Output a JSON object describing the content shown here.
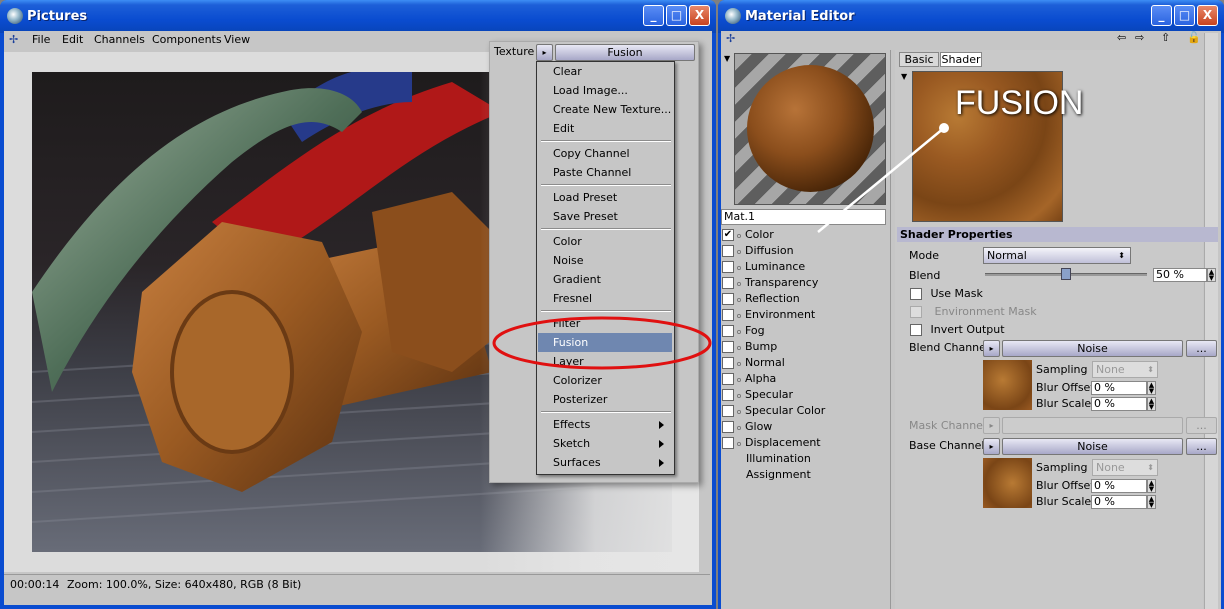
{
  "pictures": {
    "title": "Pictures",
    "menu": [
      "File",
      "Edit",
      "Channels",
      "Components",
      "View"
    ],
    "status": {
      "time": "00:00:14",
      "info": "Zoom: 100.0%, Size: 640x480, RGB (8 Bit)"
    },
    "window_buttons": {
      "minimize": "_",
      "maximize": "□",
      "close": "X"
    }
  },
  "texture_menu": {
    "label": "Texture",
    "current": "Fusion",
    "groups": [
      [
        "Clear",
        "Load Image...",
        "Create New Texture...",
        "Edit"
      ],
      [
        "Copy Channel",
        "Paste Channel"
      ],
      [
        "Load Preset",
        "Save Preset"
      ],
      [
        "Color",
        "Noise",
        "Gradient",
        "Fresnel"
      ],
      [
        "Filter",
        "Fusion",
        "Layer",
        "Colorizer",
        "Posterizer"
      ],
      [
        "Effects",
        "Sketch",
        "Surfaces"
      ]
    ],
    "selected": "Fusion",
    "submenus": [
      "Effects",
      "Sketch",
      "Surfaces"
    ]
  },
  "material_editor": {
    "title": "Material Editor",
    "mat_name": "Mat.1",
    "tabs": [
      "Basic",
      "Shader"
    ],
    "active_tab": "Shader",
    "preview_label": "FUSION",
    "channels": [
      {
        "name": "Color",
        "checked": true
      },
      {
        "name": "Diffusion",
        "checked": false
      },
      {
        "name": "Luminance",
        "checked": false
      },
      {
        "name": "Transparency",
        "checked": false
      },
      {
        "name": "Reflection",
        "checked": false
      },
      {
        "name": "Environment",
        "checked": false
      },
      {
        "name": "Fog",
        "checked": false
      },
      {
        "name": "Bump",
        "checked": false
      },
      {
        "name": "Normal",
        "checked": false
      },
      {
        "name": "Alpha",
        "checked": false
      },
      {
        "name": "Specular",
        "checked": false
      },
      {
        "name": "Specular Color",
        "checked": false
      },
      {
        "name": "Glow",
        "checked": false
      },
      {
        "name": "Displacement",
        "checked": false
      }
    ],
    "extra_items": [
      "Illumination",
      "Assignment"
    ],
    "shader": {
      "section": "Shader Properties",
      "mode_label": "Mode",
      "mode_value": "Normal",
      "blend_label": "Blend",
      "blend_value": "50 %",
      "blend_fraction": 0.5,
      "use_mask": "Use Mask",
      "env_mask": "Environment Mask",
      "invert_output": "Invert Output",
      "blend_channel_label": "Blend Channel",
      "blend_channel_value": "Noise",
      "mask_channel_label": "Mask Channel",
      "base_channel_label": "Base Channel",
      "base_channel_value": "Noise",
      "more": "...",
      "sampling_label": "Sampling",
      "sampling_value": "None",
      "blur_offset_label": "Blur Offset",
      "blur_offset_value": "0 %",
      "blur_scale_label": "Blur Scale",
      "blur_scale_value": "0 %"
    }
  },
  "colors": {
    "xp_blue": "#0a4cd0",
    "highlight": "#6f87b0",
    "annotation_red": "#e01010",
    "rust": "#9a5a22"
  }
}
